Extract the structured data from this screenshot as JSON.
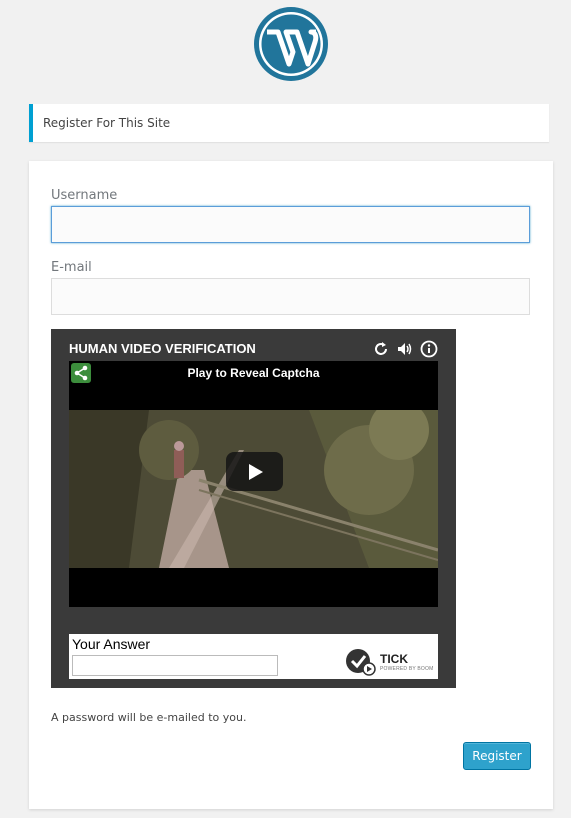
{
  "header": {
    "logo_icon": "wordpress-logo-icon"
  },
  "message": {
    "text": "Register For This Site"
  },
  "form": {
    "username": {
      "label": "Username",
      "value": ""
    },
    "email": {
      "label": "E-mail",
      "value": ""
    },
    "captcha": {
      "title": "HUMAN VIDEO VERIFICATION",
      "tools": [
        "refresh-icon",
        "speaker-icon",
        "info-icon"
      ],
      "video_caption": "Play to Reveal Captcha",
      "share_icon": "share-icon",
      "play_icon": "play-icon",
      "answer_label": "Your Answer",
      "answer_value": "",
      "brand_name": "TICK",
      "brand_sub": "POWERED BY BOOM"
    },
    "password_note": "A password will be e-mailed to you.",
    "register_label": "Register"
  },
  "colors": {
    "accent": "#00a0d2",
    "button": "#2ea2cc",
    "logo": "#21759b",
    "background": "#f1f1f1"
  }
}
